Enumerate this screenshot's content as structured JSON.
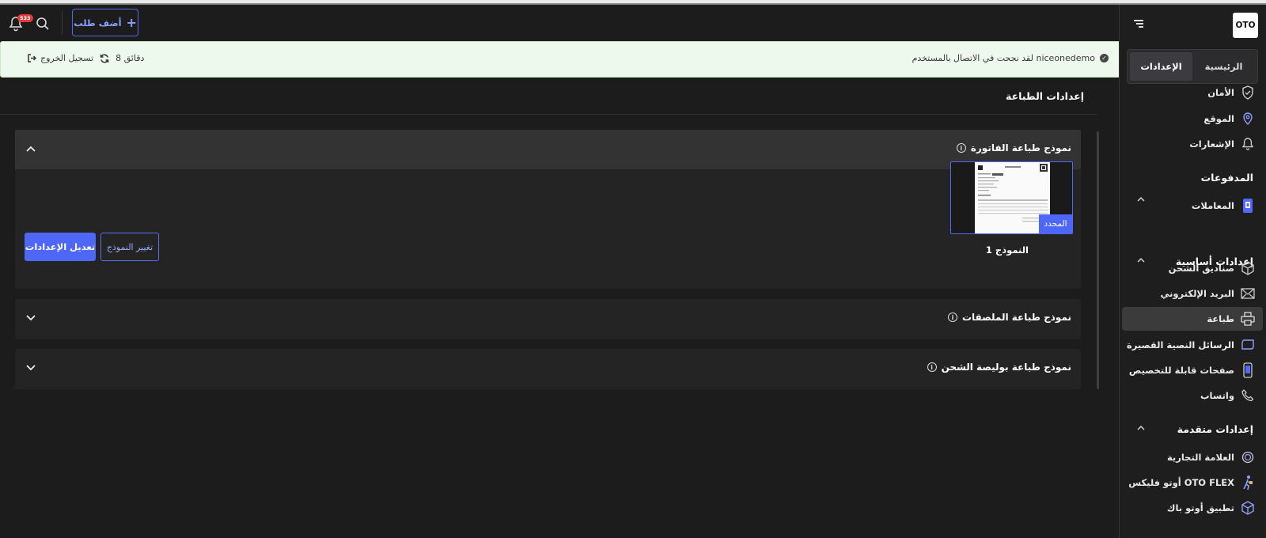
{
  "app": {
    "logo_text": "OTO"
  },
  "header": {
    "notifications_count": "533",
    "add_order_label": "أضف طلب"
  },
  "banner": {
    "message": "لقد نجحت في الاتصال بالمستخدم niceonedemo",
    "time": "8 دقائق",
    "logout_label": "تسجيل الخروج"
  },
  "sidebar": {
    "tabs": [
      {
        "label": "الرئيسية",
        "active": false
      },
      {
        "label": "الإعدادات",
        "active": true
      }
    ],
    "items": [
      {
        "label": "الأمان",
        "icon": "shield-icon"
      },
      {
        "label": "الموقع",
        "icon": "location-pin-icon"
      },
      {
        "label": "الإشعارات",
        "icon": "bell-icon"
      }
    ],
    "payments": {
      "title": "المدفوعات",
      "items": [
        {
          "label": "المعاملات",
          "icon": "transactions-icon"
        }
      ]
    },
    "basic": {
      "title": "إعدادات أساسية",
      "items": [
        {
          "label": "صناديق الشحن",
          "icon": "box-icon"
        },
        {
          "label": "البريد الإلكتروني",
          "icon": "mail-icon"
        },
        {
          "label": "طباعة",
          "icon": "printer-icon",
          "active": true
        },
        {
          "label": "الرسائل النصية القصيرة",
          "icon": "sms-icon"
        },
        {
          "label": "صفحات قابلة للتخصيص",
          "icon": "phone-page-icon"
        },
        {
          "label": "واتساب",
          "icon": "phone-icon"
        }
      ]
    },
    "advanced": {
      "title": "إعدادات متقدمة",
      "items": [
        {
          "label": "العلامة التجارية",
          "icon": "brand-icon"
        },
        {
          "label": "أوتو فليكس OTO FLEX",
          "icon": "courier-icon"
        },
        {
          "label": "تطبيق أوتو باك",
          "icon": "package-icon"
        }
      ]
    }
  },
  "main": {
    "page_title": "إعدادات الطباعة",
    "panels": [
      {
        "title": "نموذج طباعة الفاتورة",
        "expanded": true,
        "thumbnail_badge": "المحدد",
        "model_label": "النموذج 1",
        "edit_button": "تعديل الإعدادات",
        "change_button": "تغيير النموذج"
      },
      {
        "title": "نموذج طباعة الملصقات",
        "expanded": false
      },
      {
        "title": "نموذج طباعة بوليصة الشحن",
        "expanded": false
      }
    ]
  },
  "colors": {
    "accent": "#4f67f7",
    "banner_bg": "#eef9ee",
    "badge": "#e23b3b"
  }
}
